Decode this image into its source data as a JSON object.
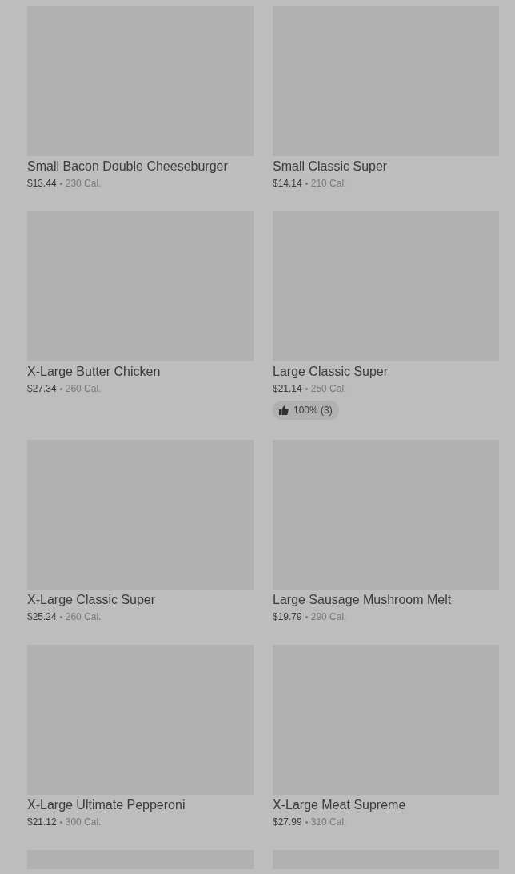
{
  "items": [
    {
      "kind": "product",
      "title": "Small Bacon Double Cheeseburger",
      "price": "$13.44",
      "calories": "230 Cal."
    },
    {
      "kind": "product",
      "title": "Small Classic Super",
      "price": "$14.14",
      "calories": "210 Cal."
    },
    {
      "kind": "product",
      "title": "X-Large Butter Chicken",
      "price": "$27.34",
      "calories": "260 Cal."
    },
    {
      "kind": "product",
      "title": "Large Classic Super",
      "price": "$21.14",
      "calories": "250 Cal.",
      "rating": "100% (3)"
    },
    {
      "kind": "product",
      "title": "X-Large Classic Super",
      "price": "$25.24",
      "calories": "260 Cal."
    },
    {
      "kind": "product",
      "title": "Large Sausage Mushroom Melt",
      "price": "$19.79",
      "calories": "290 Cal."
    },
    {
      "kind": "product",
      "title": "X-Large Ultimate Pepperoni",
      "price": "$21.12",
      "calories": "300 Cal."
    },
    {
      "kind": "product",
      "title": "X-Large Meat Supreme",
      "price": "$27.99",
      "calories": "310 Cal."
    },
    {
      "kind": "cut_off"
    },
    {
      "kind": "cut_off"
    }
  ]
}
